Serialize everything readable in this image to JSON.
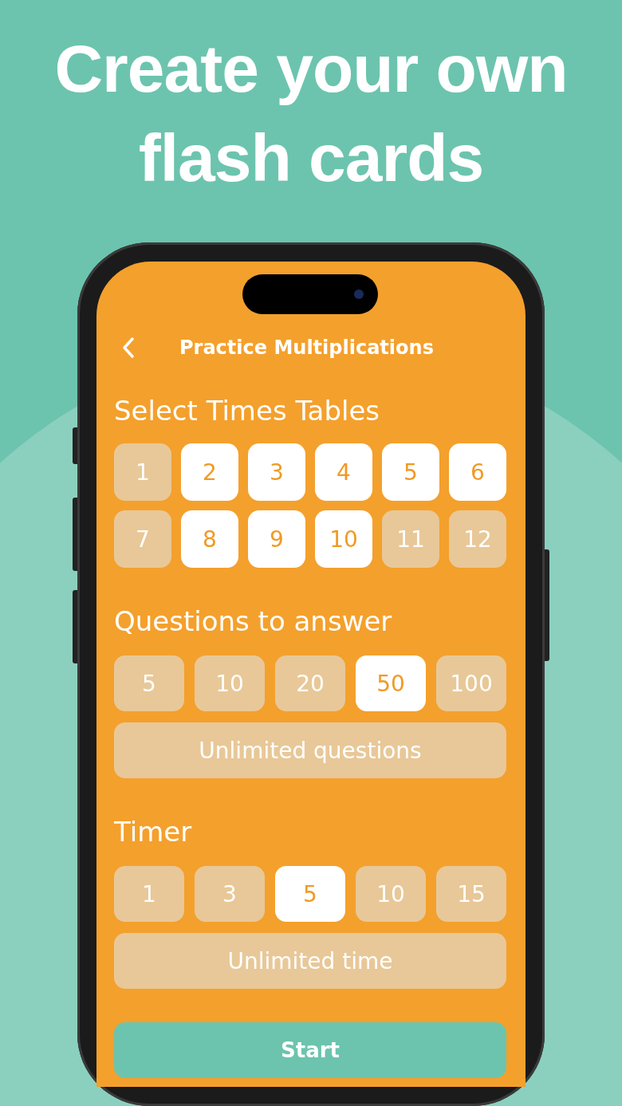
{
  "headline": "Create your own\nflash cards",
  "nav": {
    "title": "Practice Multiplications"
  },
  "sections": [
    {
      "heading": "Select Times Tables",
      "kind": "grid",
      "options": [
        {
          "label": "1",
          "selected": false
        },
        {
          "label": "2",
          "selected": true
        },
        {
          "label": "3",
          "selected": true
        },
        {
          "label": "4",
          "selected": true
        },
        {
          "label": "5",
          "selected": true
        },
        {
          "label": "6",
          "selected": true
        },
        {
          "label": "7",
          "selected": false
        },
        {
          "label": "8",
          "selected": true
        },
        {
          "label": "9",
          "selected": true
        },
        {
          "label": "10",
          "selected": true
        },
        {
          "label": "11",
          "selected": false
        },
        {
          "label": "12",
          "selected": false
        }
      ]
    },
    {
      "heading": "Questions to answer",
      "kind": "row",
      "options": [
        {
          "label": "5",
          "selected": false
        },
        {
          "label": "10",
          "selected": false
        },
        {
          "label": "20",
          "selected": false
        },
        {
          "label": "50",
          "selected": true
        },
        {
          "label": "100",
          "selected": false
        }
      ],
      "unlimited": {
        "label": "Unlimited questions",
        "selected": false
      }
    },
    {
      "heading": "Timer",
      "kind": "row",
      "options": [
        {
          "label": "1",
          "selected": false
        },
        {
          "label": "3",
          "selected": false
        },
        {
          "label": "5",
          "selected": true
        },
        {
          "label": "10",
          "selected": false
        },
        {
          "label": "15",
          "selected": false
        }
      ],
      "unlimited": {
        "label": "Unlimited time",
        "selected": false
      }
    }
  ],
  "start_button": "Start"
}
